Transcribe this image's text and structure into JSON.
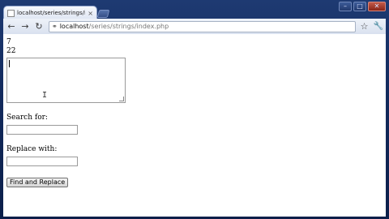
{
  "browser": {
    "tab_title": "localhost/series/strings/i...",
    "tab_close": "×",
    "url_host": "localhost",
    "url_path": "/series/strings/index.php",
    "window_controls": [
      "–",
      "□",
      "✕"
    ]
  },
  "page": {
    "output_line_1": "7",
    "output_line_2": "22",
    "textarea_value": "",
    "search_label": "Search for:",
    "search_value": "",
    "replace_label": "Replace with:",
    "replace_value": "",
    "submit_label": "Find and Replace"
  }
}
